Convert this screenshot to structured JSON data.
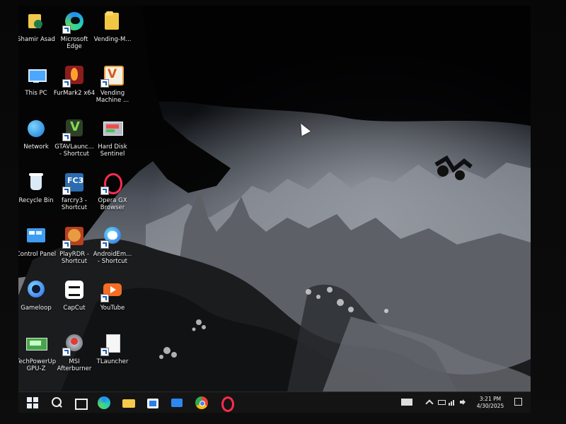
{
  "desktop": {
    "icons": [
      {
        "label": "Shamir Asad",
        "icon": "user-folder-icon"
      },
      {
        "label": "Microsoft\nEdge",
        "icon": "edge-icon"
      },
      {
        "label": "Vending-M...",
        "icon": "folder-icon"
      },
      {
        "label": "This PC",
        "icon": "this-pc-icon"
      },
      {
        "label": "FurMark2 x64",
        "icon": "furmark-icon"
      },
      {
        "label": "Vending\nMachine ...",
        "icon": "vending-machine-icon"
      },
      {
        "label": "Network",
        "icon": "network-icon"
      },
      {
        "label": "GTAVLaunc...\n- Shortcut",
        "icon": "gta-launcher-icon"
      },
      {
        "label": "Hard Disk\nSentinel",
        "icon": "hard-disk-sentinel-icon"
      },
      {
        "label": "Recycle Bin",
        "icon": "recycle-bin-icon"
      },
      {
        "label": "farcry3 -\nShortcut",
        "icon": "farcry3-icon"
      },
      {
        "label": "Opera GX\nBrowser",
        "icon": "opera-gx-icon"
      },
      {
        "label": "Control Panel",
        "icon": "control-panel-icon"
      },
      {
        "label": "PlayRDR -\nShortcut",
        "icon": "rdr-icon"
      },
      {
        "label": "AndroidEm...\n- Shortcut",
        "icon": "android-emulator-icon"
      },
      {
        "label": "Gameloop",
        "icon": "gameloop-icon"
      },
      {
        "label": "CapCut",
        "icon": "capcut-icon"
      },
      {
        "label": "YouTube",
        "icon": "youtube-icon"
      },
      {
        "label": "TechPowerUp\nGPU-Z",
        "icon": "gpuz-icon"
      },
      {
        "label": "MSI\nAfterburner",
        "icon": "msi-afterburner-icon"
      },
      {
        "label": "TLauncher",
        "icon": "tlauncher-icon"
      }
    ]
  },
  "taskbar": {
    "items": [
      "windows-start-icon",
      "search-icon",
      "task-view-icon",
      "edge-icon",
      "file-explorer-icon",
      "store-icon",
      "mail-icon",
      "chrome-icon",
      "opera-icon"
    ],
    "tray": {
      "time": "3:21 PM",
      "date": "4/30/2025",
      "icons": [
        "keyboard-icon",
        "chevron-up-icon",
        "battery-icon",
        "network-icon",
        "volume-icon",
        "notifications-icon"
      ]
    }
  }
}
